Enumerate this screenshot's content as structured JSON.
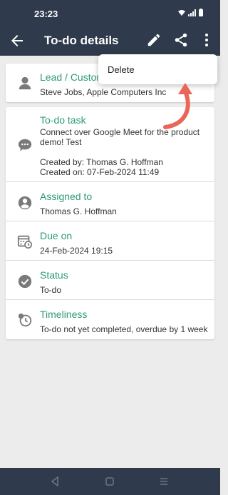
{
  "status_bar": {
    "time": "23:23"
  },
  "app_bar": {
    "title": "To-do details"
  },
  "menu": {
    "delete_label": "Delete"
  },
  "lead": {
    "title": "Lead / Custom",
    "value": "Steve Jobs, Apple Computers Inc"
  },
  "task": {
    "title": "To-do task",
    "description_line1": "Connect over Google Meet for the product",
    "description_line2": "demo! Test",
    "created_by": "Created by: Thomas G. Hoffman",
    "created_on": "Created on: 07-Feb-2024 11:49"
  },
  "assigned": {
    "title": "Assigned to",
    "value": "Thomas G. Hoffman"
  },
  "due": {
    "title": "Due on",
    "value": "24-Feb-2024 19:15"
  },
  "status": {
    "title": "Status",
    "value": "To-do"
  },
  "timeliness": {
    "title": "Timeliness",
    "value": "To-do not yet completed, overdue by 1 week"
  },
  "colors": {
    "accent": "#2e9a7a",
    "bar": "#2f3b4c",
    "arrow": "#e8665a"
  }
}
